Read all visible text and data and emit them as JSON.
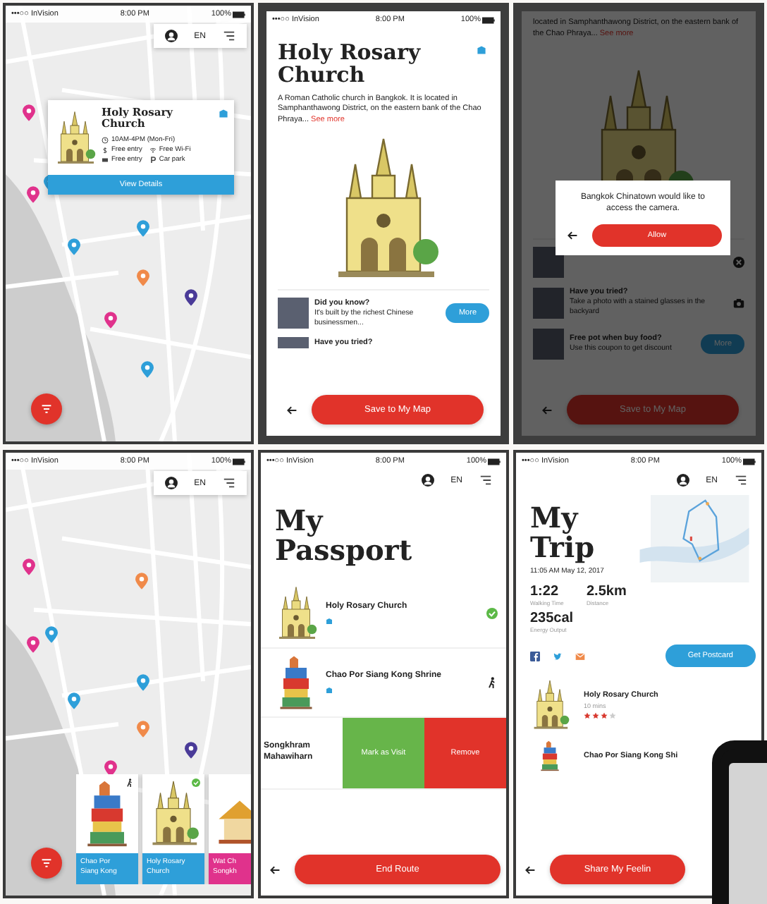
{
  "screens": [
    {
      "kind": "map",
      "status": {
        "carrier": "•••○○ InVision",
        "time": "8:00 PM",
        "battery": "100%"
      },
      "toolbar": {
        "language": "EN"
      },
      "pins": [
        {
          "color": "#e0328c"
        },
        {
          "color": "#e0328c"
        },
        {
          "color": "#2e9fd9"
        },
        {
          "color": "#2e9fd9"
        },
        {
          "color": "#2e9fd9"
        },
        {
          "color": "#f08a4a"
        },
        {
          "color": "#4a3b98"
        },
        {
          "color": "#e0328c"
        },
        {
          "color": "#2e9fd9"
        }
      ],
      "popup": {
        "title": "Holy Rosary Church",
        "hours": "10AM-4PM (Mon-Fri)",
        "features": [
          "Free entry",
          "Free Wi-Fi",
          "Free entry",
          "Car park"
        ],
        "button": "View Details"
      }
    },
    {
      "kind": "detail",
      "status": {
        "carrier": "•••○○ InVision",
        "time": "8:00 PM",
        "battery": "100%"
      },
      "title": "Holy Rosary Church",
      "description": "A Roman Catholic church in Bangkok. It is located in Samphanthawong District, on the eastern bank of the Chao Phraya...",
      "link": "See more",
      "cards": [
        {
          "kind": "button",
          "title": "Did you know?",
          "text": "It's built by the richest Chinese businessmen...",
          "button": "More"
        },
        {
          "kind": "plain",
          "title": "Have you tried?"
        }
      ],
      "primary": "Save to My Map"
    },
    {
      "kind": "dialog",
      "description": "located in Samphanthawong District, on the eastern bank of the Chao Phraya...",
      "link": "See more",
      "cards": [
        {
          "kind": "close"
        },
        {
          "kind": "camera",
          "title": "Have you tried?",
          "text": "Take a photo with a stained glasses in the backyard"
        },
        {
          "kind": "button",
          "title": "Free pot when buy food?",
          "text": "Use this coupon to get discount",
          "button": "More"
        }
      ],
      "dialog": {
        "message": "Bangkok Chinatown would like to access the camera.",
        "button": "Allow"
      },
      "primary": "Save to My Map"
    },
    {
      "kind": "map",
      "status": {
        "carrier": "•••○○ InVision",
        "time": "8:00 PM",
        "battery": "100%"
      },
      "toolbar": {
        "language": "EN"
      },
      "pins": [
        {
          "color": "#e0328c"
        },
        {
          "color": "#f08a4a"
        },
        {
          "color": "#e0328c"
        },
        {
          "color": "#2e9fd9"
        },
        {
          "color": "#2e9fd9"
        },
        {
          "color": "#2e9fd9"
        },
        {
          "color": "#f08a4a"
        },
        {
          "color": "#4a3b98"
        },
        {
          "color": "#e0328c"
        }
      ],
      "cards": [
        {
          "kind": "shrine",
          "title": "Chao Por Siang Kong",
          "visited": false,
          "color": "#2e9fd9"
        },
        {
          "kind": "church",
          "title": "Holy Rosary Church",
          "visited": true,
          "color": "#2e9fd9"
        },
        {
          "kind": "temple",
          "title": "Wat Ch Songkh",
          "color": "#e0328c"
        }
      ]
    },
    {
      "kind": "passport",
      "status": {
        "carrier": "•••○○ InVision",
        "time": "8:00 PM",
        "battery": "100%"
      },
      "toolbar": {
        "language": "EN"
      },
      "title": "My Passport",
      "items": [
        {
          "kind": "church",
          "title": "Holy Rosary Church",
          "visited": true
        },
        {
          "kind": "shrine",
          "title": "Chao Por Siang Kong Shrine",
          "visited": false
        },
        {
          "kind": "swiped",
          "title": "Songkhram Mahawiharn",
          "actions": [
            "Mark as Visit",
            "Remove"
          ]
        }
      ],
      "primary": "End Route"
    },
    {
      "kind": "trip",
      "status": {
        "carrier": "•••○○ InVision",
        "time": "8:00 PM",
        "battery": "100%"
      },
      "toolbar": {
        "language": "EN"
      },
      "title": "My Trip",
      "date": "11:05 AM May 12, 2017",
      "stats": [
        {
          "value": "1:22",
          "label": "Walking Time"
        },
        {
          "value": "2.5km",
          "label": "Distance"
        },
        {
          "value": "235cal",
          "label": "Energy Output"
        }
      ],
      "button": "Get Postcard",
      "stops": [
        {
          "kind": "church",
          "title": "Holy Rosary Church",
          "duration": "10 mins",
          "stars": 3
        },
        {
          "kind": "shrine",
          "title": "Chao Por Siang Kong Shi"
        }
      ],
      "primary": "Share My Feelin"
    }
  ]
}
